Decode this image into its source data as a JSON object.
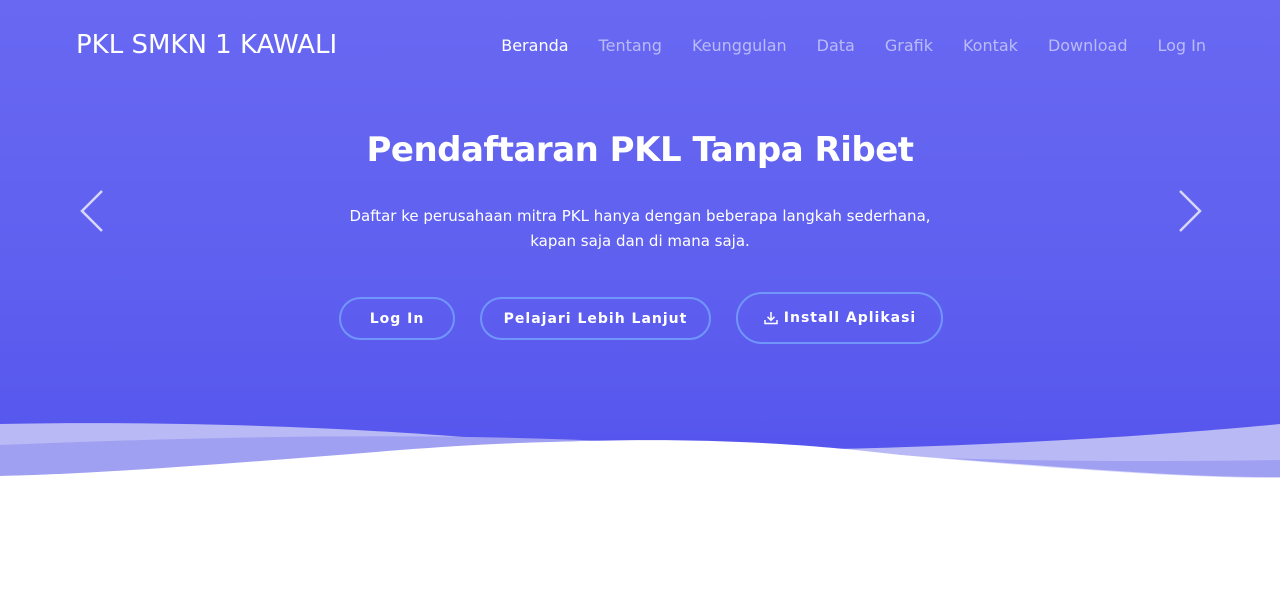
{
  "brand": {
    "name": "PKL SMKN 1 KAWALI"
  },
  "nav": {
    "items": [
      {
        "label": "Beranda",
        "active": true
      },
      {
        "label": "Tentang",
        "active": false
      },
      {
        "label": "Keunggulan",
        "active": false
      },
      {
        "label": "Data",
        "active": false
      },
      {
        "label": "Grafik",
        "active": false
      },
      {
        "label": "Kontak",
        "active": false
      },
      {
        "label": "Download",
        "active": false
      },
      {
        "label": "Log In",
        "active": false
      }
    ]
  },
  "hero": {
    "title": "Pendaftaran PKL Tanpa Ribet",
    "subtitle_line1": "Daftar ke perusahaan mitra PKL hanya dengan beberapa langkah sederhana,",
    "subtitle_line2": "kapan saja dan di mana saja.",
    "buttons": {
      "login": "Log In",
      "learn_more": "Pelajari Lebih Lanjut",
      "install": "Install Aplikasi"
    },
    "carousel": {
      "prev_icon": "chevron-left-icon",
      "next_icon": "chevron-right-icon"
    }
  },
  "colors": {
    "hero_top": "#6868f2",
    "hero_bottom": "#5454ee",
    "button_border": "#78aaff",
    "nav_active": "#ffffff",
    "nav_inactive": "#c4c4f9"
  }
}
